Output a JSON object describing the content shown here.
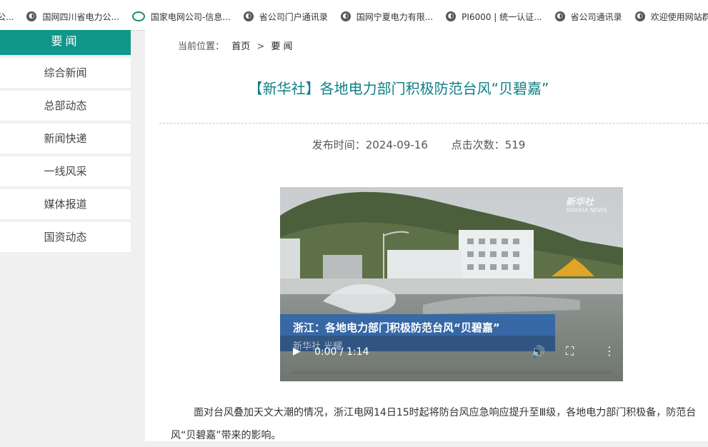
{
  "bookmarks": [
    {
      "label": "公...",
      "icon": "globe-icon"
    },
    {
      "label": "国网四川省电力公...",
      "icon": "globe-icon"
    },
    {
      "label": "国家电网公司-信息...",
      "icon": "sgcc-logo-icon"
    },
    {
      "label": "省公司门户通讯录",
      "icon": "globe-icon"
    },
    {
      "label": "国网宁夏电力有限...",
      "icon": "globe-icon"
    },
    {
      "label": "PI6000 | 统一认证...",
      "icon": "globe-icon"
    },
    {
      "label": "省公司通讯录",
      "icon": "globe-icon"
    },
    {
      "label": "欢迎使用网站群内",
      "icon": "globe-icon"
    }
  ],
  "sidebar": {
    "header": "要闻",
    "items": [
      "综合新闻",
      "总部动态",
      "新闻快递",
      "一线风采",
      "媒体报道",
      "国资动态"
    ]
  },
  "breadcrumb": {
    "prefix": "当前位置：",
    "home": "首页",
    "separator": ">",
    "current": "要 闻"
  },
  "article": {
    "title": "【新华社】各地电力部门积极防范台风“贝碧嘉”",
    "publish_label": "发布时间：2024-09-16",
    "clicks_label": "点击次数：519",
    "paragraph": "面对台风叠加天文大潮的情况，浙江电网14日15时起将防台风应急响应提升至Ⅲ级，各地电力部门积极备，防范台风“贝碧嘉”带来的影响。"
  },
  "video": {
    "caption": "浙江：各地电力部门积极防范台风“贝碧嘉”",
    "subcaption": "新华社 光耀",
    "watermark": "新华社",
    "watermark_sub": "XINHUA NEWS",
    "time": "0:00 / 1:14",
    "progress": 0
  },
  "colors": {
    "accent": "#11968a",
    "title": "#0f7f86"
  }
}
